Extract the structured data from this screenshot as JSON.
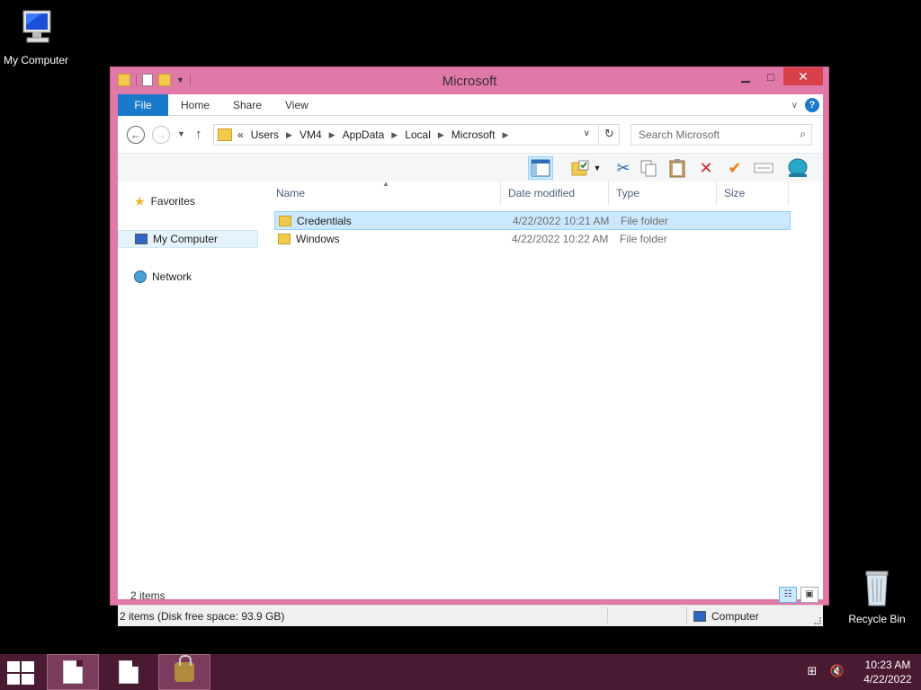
{
  "desktop": {
    "my_computer_label": "My Computer",
    "recycle_bin_label": "Recycle Bin"
  },
  "window": {
    "title": "Microsoft",
    "min_glyph": "▭",
    "max_glyph": "□",
    "close_glyph": "✕"
  },
  "ribbon": {
    "tabs": [
      {
        "label": "File"
      },
      {
        "label": "Home"
      },
      {
        "label": "Share"
      },
      {
        "label": "View"
      }
    ],
    "help_glyph": "?"
  },
  "address": {
    "overflow": "«",
    "crumbs": [
      "Users",
      "VM4",
      "AppData",
      "Local",
      "Microsoft"
    ],
    "search_placeholder": "Search Microsoft"
  },
  "navpane": {
    "items": [
      {
        "label": "Favorites",
        "icon": "star-icon"
      },
      {
        "label": "My Computer",
        "icon": "computer-icon",
        "selected": true
      },
      {
        "label": "Network",
        "icon": "network-icon"
      }
    ]
  },
  "filelist": {
    "columns": [
      "Name",
      "Date modified",
      "Type",
      "Size"
    ],
    "rows": [
      {
        "name": "Credentials",
        "date": "4/22/2022 10:21 AM",
        "type": "File folder",
        "size": "",
        "selected": true
      },
      {
        "name": "Windows",
        "date": "4/22/2022 10:22 AM",
        "type": "File folder",
        "size": "",
        "selected": false
      }
    ]
  },
  "status": {
    "item_count": "2 items",
    "details": "2 items (Disk free space: 93.9 GB)",
    "location": "Computer"
  },
  "taskbar": {
    "time": "10:23 AM",
    "date": "4/22/2022"
  },
  "colors": {
    "window_frame": "#e079a8",
    "file_tab": "#1979ca",
    "selection": "#cce8ff",
    "taskbar": "#4a1a33"
  }
}
